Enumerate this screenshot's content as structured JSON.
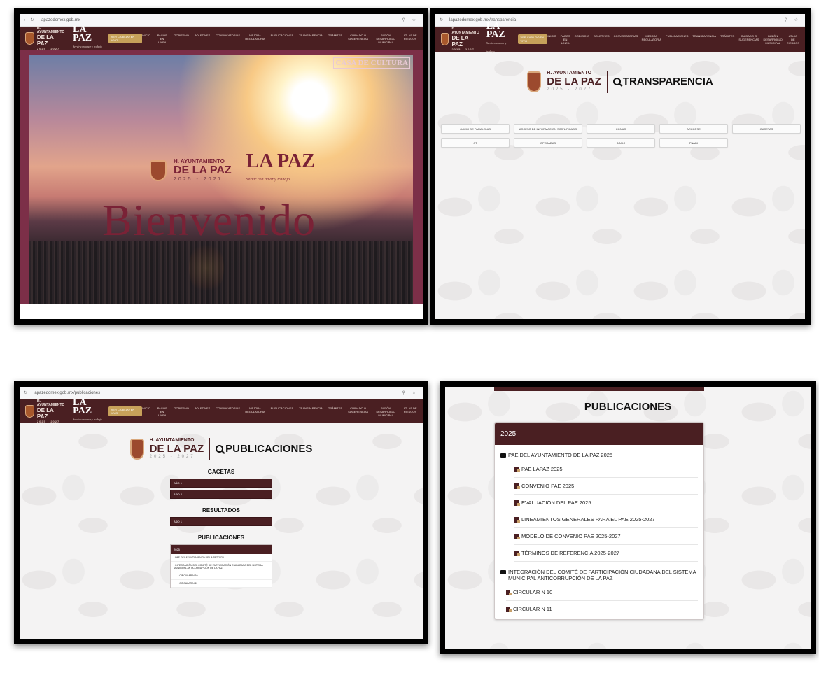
{
  "browser": {
    "url_home": "lapazedomex.gob.mx",
    "url_transparencia": "lapazedomex.gob.mx/transparencia",
    "url_publicaciones": "lapazedomex.gob.mx/publicaciones"
  },
  "header": {
    "brand_top": "H. AYUNTAMIENTO",
    "brand_name": "DE LA PAZ",
    "brand_years": "2025 - 2027",
    "brand_logo": "LA PAZ",
    "brand_slogan": "Servir con amor y trabajo",
    "live_label": "VER CABILDO EN VIVO",
    "menu": [
      "INICIO",
      "PAGOS EN LÍNEA",
      "GOBIERNO",
      "BOLETINES",
      "CONVOCATORIAS",
      "MEJORA REGULATORIA",
      "PUBLICACIONES",
      "TRANSPARENCIA",
      "TRÁMITES",
      "CUIDADO O SUGERENCIAS",
      "BUZÓN DESARROLLO MUNICIPAL",
      "ATLAS DE RIESGOS"
    ]
  },
  "home": {
    "casa_cultura": "CASA DE CULTURA",
    "hero_top": "H. AYUNTAMIENTO",
    "hero_name": "DE LA PAZ",
    "hero_years": "2025 - 2027",
    "hero_logo": "LA PAZ",
    "hero_slogan": "Servir con amor y trabajo",
    "welcome": "Bienvenido"
  },
  "transparencia": {
    "org_top": "H. AYUNTAMIENTO",
    "org_name": "DE LA PAZ",
    "org_years": "2025 - 2027",
    "title": "TRANSPARENCIA",
    "buttons": [
      "JUICIO DE PARALELAS",
      "ACCESO DE INFORMACION SIMPLIFICADO",
      "CONAC",
      "ARCOPSE",
      "GACETAS",
      "CT",
      "OPERADAS",
      "SOAIC",
      "PNADI"
    ]
  },
  "publicaciones_small": {
    "org_top": "H. AYUNTAMIENTO",
    "org_name": "DE LA PAZ",
    "org_years": "2025 - 2027",
    "title": "PUBLICACIONES",
    "gacetas_title": "GACETAS",
    "gacetas": [
      "AÑO 1",
      "AÑO 2"
    ],
    "resultados_title": "RESULTADOS",
    "resultados": [
      "AÑO 1"
    ],
    "publicaciones_title": "PUBLICACIONES",
    "year": "2025",
    "items": [
      "PAE DEL AYUNTAMIENTO DE LA PAZ 2025",
      "INTEGRACIÓN DEL COMITÉ DE PARTICIPACIÓN CIUDADANA DEL SISTEMA MUNICIPAL ANTICORRUPCIÓN DE LA PAZ",
      "CIRCULAR N 10",
      "CIRCULAR N 11"
    ]
  },
  "publicaciones_zoom": {
    "title": "PUBLICACIONES",
    "year": "2025",
    "group1": "PAE DEL AYUNTAMIENTO DE LA PAZ 2025",
    "group1_items": [
      "PAE LAPAZ 2025",
      "CONVENIO PAE 2025",
      "EVALUACIÓN DEL PAE 2025",
      "LINEAMIENTOS GENERALES PARA EL PAE 2025-2027",
      "MODELO DE CONVENIO PAE 2025-2027",
      "TÉRMINOS DE REFERENCIA 2025-2027"
    ],
    "group2": "INTEGRACIÓN DEL COMITÉ DE PARTICIPACIÓN CIUDADANA DEL SISTEMA MUNICIPAL ANTICORRUPCIÓN DE LA PAZ",
    "group2_items": [
      "CIRCULAR N 10",
      "CIRCULAR N 11"
    ]
  },
  "colors": {
    "brand": "#4a1f22",
    "accent": "#7a2236",
    "gold": "#c7a15a"
  }
}
